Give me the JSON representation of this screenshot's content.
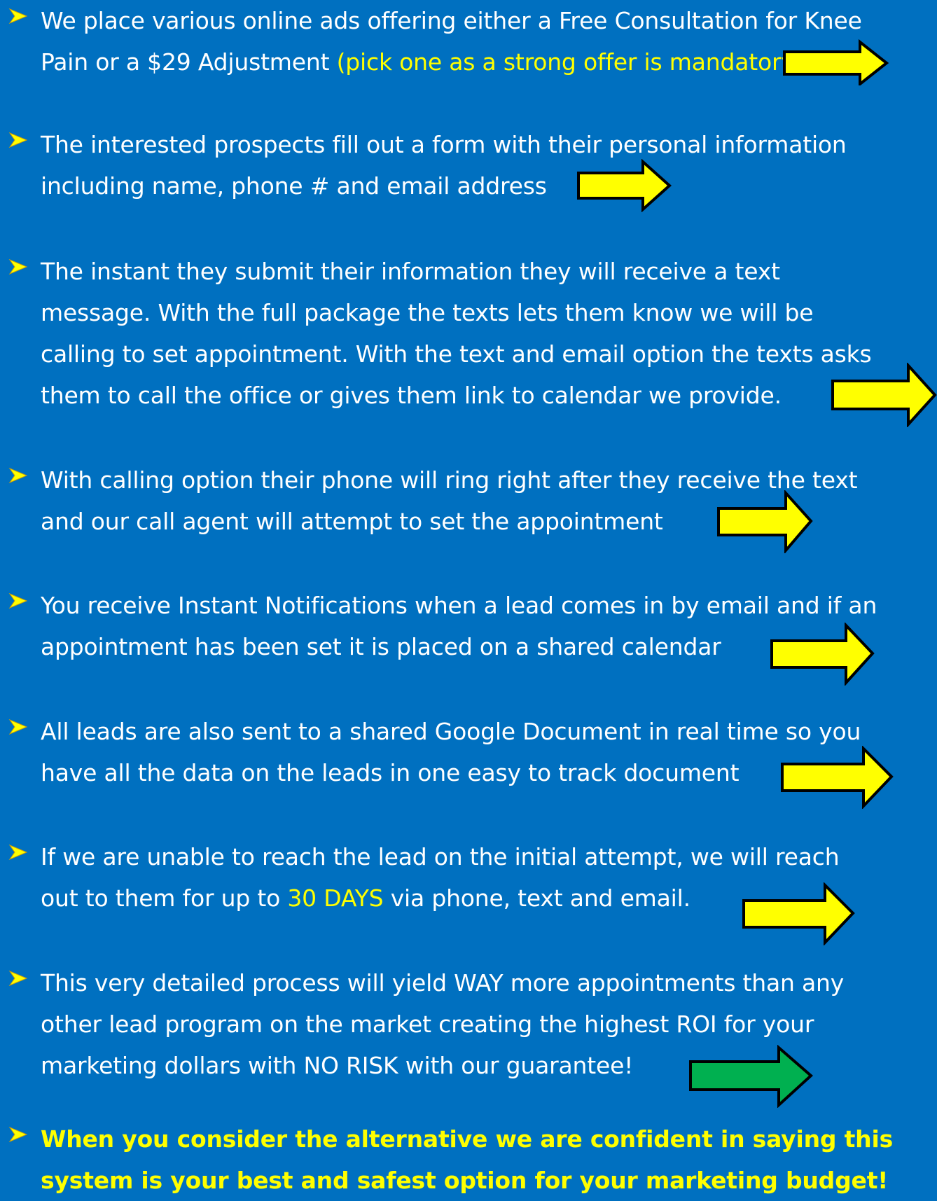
{
  "colors": {
    "background": "#0070c0",
    "text": "#ffffff",
    "highlight": "#ffff00",
    "bullet": "#ffff00",
    "arrow_yellow": "#ffff00",
    "arrow_green": "#00b050"
  },
  "items": [
    {
      "lines": [
        "We place various online ads offering either a Free Consultation for Knee",
        "Pain or a $29 Adjustment "
      ],
      "highlight": "(pick one as a strong offer is mandatory)",
      "arrow": "yellow-arrow"
    },
    {
      "lines": [
        "The interested prospects fill out a form with their personal information",
        "including name, phone # and email address"
      ],
      "arrow": "yellow-arrow"
    },
    {
      "lines": [
        "The instant they submit their information they will receive a text",
        "message. With the full package the texts lets them know we will be",
        "calling to set appointment. With the text and email option the texts asks",
        "them to call the office or gives them link to calendar we provide."
      ],
      "arrow": "yellow-arrow"
    },
    {
      "lines": [
        "With calling option their phone will ring right after they receive the text",
        "and our call agent will attempt to set the appointment"
      ],
      "arrow": "yellow-arrow"
    },
    {
      "lines": [
        "You receive Instant Notifications when a lead comes in by email and if an",
        "appointment has been set it is placed on a shared calendar"
      ],
      "arrow": "yellow-arrow"
    },
    {
      "lines": [
        "All leads are also sent to a shared Google Document in real time so you",
        "have all the data on the leads in one easy to track document"
      ],
      "arrow": "yellow-arrow"
    },
    {
      "line1": "If we are unable to reach the lead on the initial attempt, we will reach",
      "line2_pre": "out to them for up to ",
      "line2_highlight": "30 DAYS",
      "line2_post": " via phone, text and email.",
      "arrow": "yellow-arrow"
    },
    {
      "lines": [
        "This very detailed process will yield WAY more appointments than any",
        "other lead program on the market creating the highest ROI for your",
        "marketing dollars with NO RISK with our guarantee!"
      ],
      "arrow": "green-arrow"
    },
    {
      "lines": [
        "When you consider the alternative we are confident in saying this",
        "system is your best and safest option for your marketing budget!"
      ]
    }
  ]
}
